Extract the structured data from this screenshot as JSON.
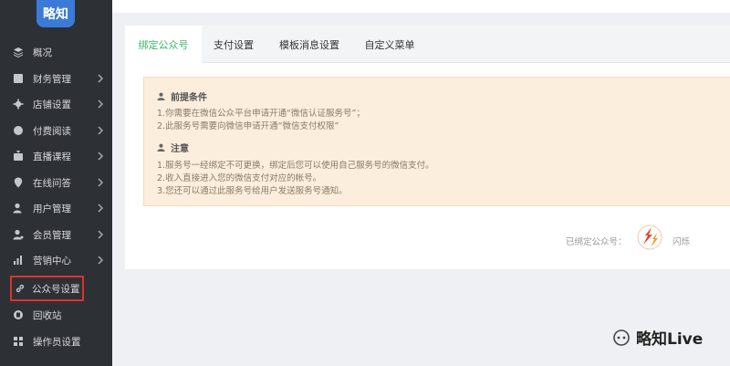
{
  "logo": {
    "text": "略知"
  },
  "sidebar": {
    "items": [
      {
        "label": "概况",
        "icon": "layers-icon",
        "chevron": false
      },
      {
        "label": "财务管理",
        "icon": "finance-icon",
        "chevron": true
      },
      {
        "label": "店铺设置",
        "icon": "gear-icon",
        "chevron": true
      },
      {
        "label": "付费阅读",
        "icon": "reading-icon",
        "chevron": true
      },
      {
        "label": "直播课程",
        "icon": "live-icon",
        "chevron": true
      },
      {
        "label": "在线问答",
        "icon": "location-icon",
        "chevron": true
      },
      {
        "label": "用户管理",
        "icon": "user-icon",
        "chevron": true
      },
      {
        "label": "会员管理",
        "icon": "member-icon",
        "chevron": true
      },
      {
        "label": "营销中心",
        "icon": "chart-icon",
        "chevron": true
      },
      {
        "label": "公众号设置",
        "icon": "link-icon",
        "chevron": false,
        "active": true
      },
      {
        "label": "回收站",
        "icon": "recycle-icon",
        "chevron": false
      },
      {
        "label": "操作员设置",
        "icon": "operator-icon",
        "chevron": false
      }
    ]
  },
  "tabs": [
    {
      "label": "绑定公众号",
      "active": true
    },
    {
      "label": "支付设置"
    },
    {
      "label": "模板消息设置"
    },
    {
      "label": "自定义菜单"
    }
  ],
  "notice": {
    "prereq_title": "前提条件",
    "prereq_lines": [
      "1.你需要在微信公众平台申请开通“微信认证服务号”；",
      "2.此服务号需要向微信申请开通“微信支付权限”"
    ],
    "note_title": "注意",
    "note_lines": [
      "1.服务号一经绑定不可更换，绑定后您可以使用自己服务号的微信支付。",
      "2.收入直接进入您的微信支付对应的帐号。",
      "3.您还可以通过此服务号给用户发送服务号通知。"
    ]
  },
  "bound": {
    "label": "已绑定公众号：",
    "name": "闪烁"
  },
  "watermark": {
    "text": "略知Live"
  },
  "colors": {
    "sidebar_bg": "#2d3035",
    "accent_green": "#3bb56b",
    "notice_bg": "#fbeedc",
    "highlight_red": "#d9342b",
    "logo_blue": "#3a7ad9"
  }
}
